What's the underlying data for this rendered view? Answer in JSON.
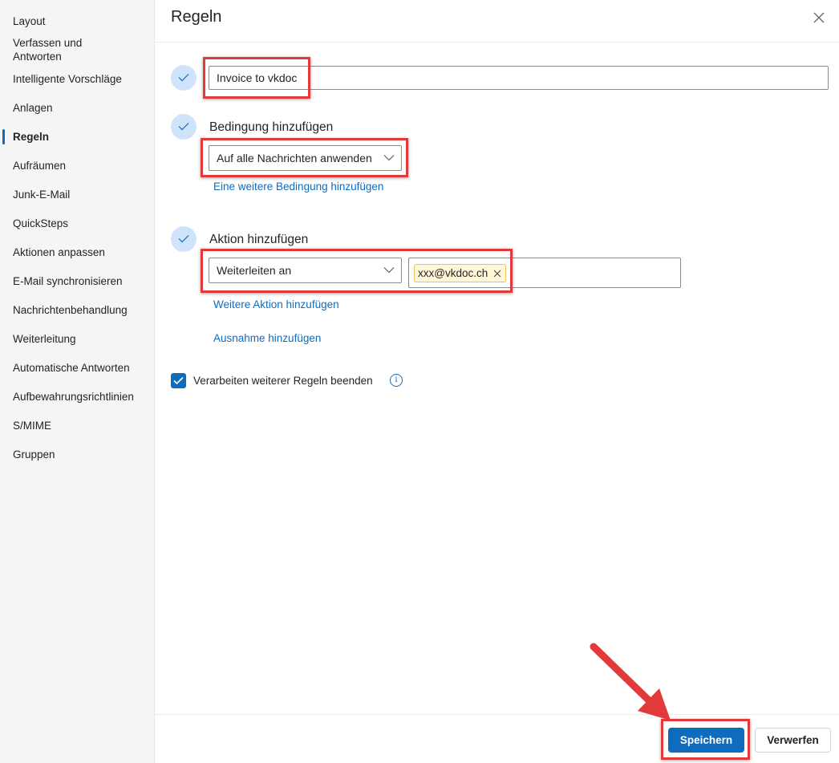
{
  "sidebar": {
    "items": [
      {
        "label": "Layout"
      },
      {
        "label": "Verfassen und Antworten"
      },
      {
        "label": "Intelligente Vorschläge"
      },
      {
        "label": "Anlagen"
      },
      {
        "label": "Regeln",
        "active": true
      },
      {
        "label": "Aufräumen"
      },
      {
        "label": "Junk-E-Mail"
      },
      {
        "label": "QuickSteps"
      },
      {
        "label": "Aktionen anpassen"
      },
      {
        "label": "E-Mail synchronisieren"
      },
      {
        "label": "Nachrichtenbehandlung"
      },
      {
        "label": "Weiterleitung"
      },
      {
        "label": "Automatische Antworten"
      },
      {
        "label": "Aufbewahrungsrichtlinien"
      },
      {
        "label": "S/MIME"
      },
      {
        "label": "Gruppen"
      }
    ]
  },
  "panel": {
    "title": "Regeln",
    "rule_name": {
      "value": "Invoice to vkdoc"
    },
    "condition": {
      "heading": "Bedingung hinzufügen",
      "selected": "Auf alle Nachrichten anwenden",
      "add_link": "Eine weitere Bedingung hinzufügen"
    },
    "action": {
      "heading": "Aktion hinzufügen",
      "selected": "Weiterleiten an",
      "recipient": "xxx@vkdoc.ch",
      "add_link": "Weitere Aktion hinzufügen"
    },
    "exception_link": "Ausnahme hinzufügen",
    "stop_processing": {
      "label": "Verarbeiten weiterer Regeln beenden",
      "checked": true
    },
    "save_label": "Speichern",
    "discard_label": "Verwerfen"
  },
  "colors": {
    "accent": "#0f6cbd",
    "annotation": "#e23a3a",
    "chip_bg": "#fff6d9"
  },
  "icons": [
    "close-icon",
    "check-icon",
    "chevron-down-icon",
    "info-icon",
    "remove-icon"
  ]
}
